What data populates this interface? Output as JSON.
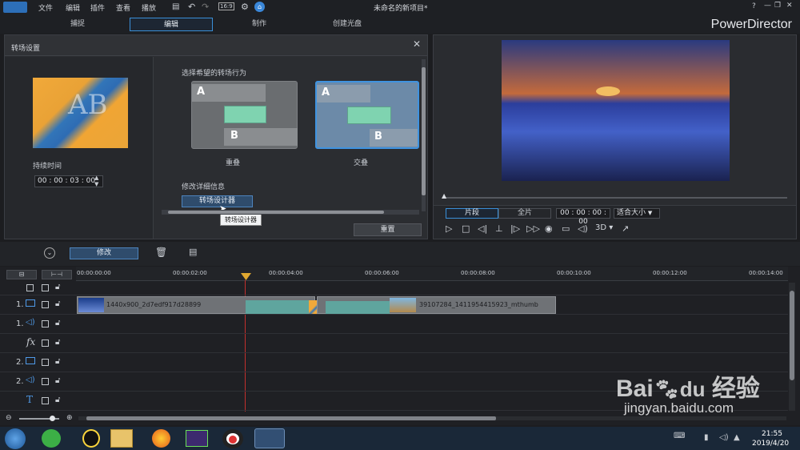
{
  "window": {
    "title": "未命名的新项目*"
  },
  "menu": [
    "文件",
    "编辑",
    "插件",
    "查看",
    "播放"
  ],
  "toolbar_icons": [
    "save-icon",
    "undo-icon",
    "redo-icon",
    "aspect-icon",
    "settings-icon",
    "upgrade-icon"
  ],
  "aspect_label": "16:9",
  "window_controls": [
    "?",
    "—",
    "❐",
    "✕"
  ],
  "modes": {
    "capture": "捕捉",
    "edit": "编辑",
    "produce": "制作",
    "disc": "创建光盘"
  },
  "brand": "PowerDirector",
  "transition": {
    "title": "转场设置",
    "duration_label": "持续时间",
    "duration_value": "00 : 00 : 03 : 00",
    "behavior_prompt": "选择希望的转场行为",
    "options": [
      {
        "label": "重叠",
        "a": "A",
        "b": "B"
      },
      {
        "label": "交叠",
        "a": "A",
        "b": "B"
      }
    ],
    "modify_label": "修改详细信息",
    "designer_button": "转场设计器",
    "tooltip": "转场设计器",
    "reset_button": "重置"
  },
  "preview": {
    "clip_tab": "片段",
    "full_tab": "全片",
    "timecode": "00 : 00 : 00 : 00",
    "fit": "适合大小",
    "mode3d": "3D"
  },
  "edit_toolbar": {
    "modify_button": "修改"
  },
  "ruler": [
    "00:00:00:00",
    "00:00:02:00",
    "00:00:04:00",
    "00:00:06:00",
    "00:00:08:00",
    "00:00:10:00",
    "00:00:12:00",
    "00:00:14:00"
  ],
  "tracks": [
    {
      "num": "1.",
      "type": "video"
    },
    {
      "num": "1.",
      "type": "audio"
    },
    {
      "num": "",
      "type": "fx"
    },
    {
      "num": "2.",
      "type": "video"
    },
    {
      "num": "2.",
      "type": "audio"
    },
    {
      "num": "",
      "type": "title"
    }
  ],
  "fx_label": "fx",
  "title_glyph": "T",
  "clips": [
    {
      "name": "1440x900_2d7edf917d28899"
    },
    {
      "name": "39107284_1411954415923_mthumb"
    }
  ],
  "taskbar": {
    "time": "21:55",
    "date": "2019/4/20"
  },
  "watermark": {
    "site": "jingyan.baidu.com",
    "brand": "Bai",
    "brand2": "经验"
  }
}
